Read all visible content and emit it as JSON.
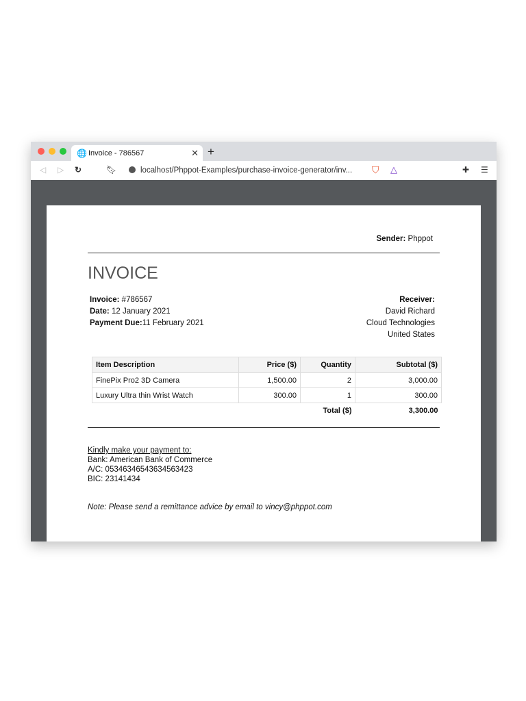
{
  "browser": {
    "tab_title": "Invoice - 786567",
    "url": "localhost/Phppot-Examples/purchase-invoice-generator/inv..."
  },
  "invoice": {
    "sender_label": "Sender:",
    "sender": "Phppot",
    "title": "INVOICE",
    "number_label": "Invoice:",
    "number": "#786567",
    "date_label": "Date:",
    "date": "12 January 2021",
    "due_label": "Payment Due:",
    "due": "11 February 2021",
    "receiver_label": "Receiver:",
    "receiver": [
      "David Richard",
      "Cloud Technologies",
      "United States"
    ],
    "table": {
      "headers": [
        "Item Description",
        "Price ($)",
        "Quantity",
        "Subtotal ($)"
      ],
      "rows": [
        [
          "FinePix Pro2 3D Camera",
          "1,500.00",
          "2",
          "3,000.00"
        ],
        [
          "Luxury Ultra thin Wrist Watch",
          "300.00",
          "1",
          "300.00"
        ]
      ],
      "total_label": "Total ($)",
      "total": "3,300.00"
    },
    "payment": {
      "heading": "Kindly make your payment to:",
      "bank": "Bank: American Bank of Commerce",
      "ac": "A/C: 05346346543634563423",
      "bic": "BIC: 23141434"
    },
    "note": "Note: Please send a remittance advice by email to vincy@phppot.com"
  }
}
